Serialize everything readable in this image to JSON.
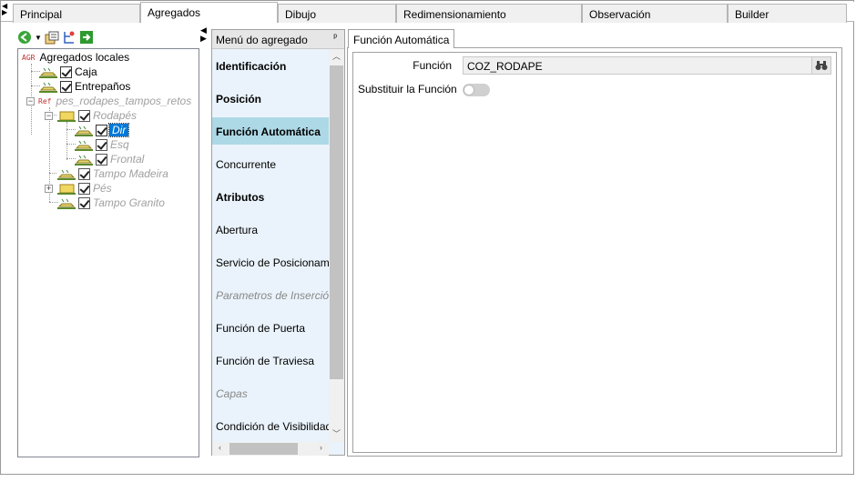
{
  "tabs": [
    "Principal",
    "Agregados",
    "Dibujo",
    "Redimensionamiento",
    "Observación",
    "Builder"
  ],
  "tree": {
    "root": {
      "tag": "AGR",
      "label": "Agregados locales"
    },
    "items": [
      {
        "label": "Caja"
      },
      {
        "label": "Entrepaños"
      }
    ],
    "ref": {
      "tag": "Ref",
      "label": "pes_rodapes_tampos_retos"
    },
    "rodapes": {
      "label": "Rodapés"
    },
    "rodapes_children": [
      {
        "label": "Dir"
      },
      {
        "label": "Esq"
      },
      {
        "label": "Frontal"
      }
    ],
    "tampo_madeira": {
      "label": "Tampo Madeira"
    },
    "pes": {
      "label": "Pés"
    },
    "tampo_granito": {
      "label": "Tampo Granito"
    }
  },
  "menu": {
    "title": "Menú do agregado",
    "items": [
      {
        "label": "Identificación",
        "style": "bold"
      },
      {
        "label": "Posición",
        "style": "bold"
      },
      {
        "label": "Función Automática",
        "style": "active"
      },
      {
        "label": "Concurrente",
        "style": "normal"
      },
      {
        "label": "Atributos",
        "style": "bold"
      },
      {
        "label": "Abertura",
        "style": "normal"
      },
      {
        "label": "Servicio de Posicionamiento",
        "style": "normal"
      },
      {
        "label": "Parametros de Inserción",
        "style": "italic"
      },
      {
        "label": "Función de Puerta",
        "style": "normal"
      },
      {
        "label": "Función de Traviesa",
        "style": "normal"
      },
      {
        "label": "Capas",
        "style": "italic"
      },
      {
        "label": "Condición de Visibilidad",
        "style": "normal"
      }
    ]
  },
  "detail": {
    "tab": "Función Automática",
    "funcion_label": "Función",
    "funcion_value": "COZ_RODAPE",
    "substituir_label": "Substituir la Función",
    "substituir_on": false
  },
  "colors": {
    "accent": "#0078d7",
    "menu_bg": "#eaf3fb",
    "menu_active": "#add8e6",
    "agg_icon": "#e8d870"
  }
}
